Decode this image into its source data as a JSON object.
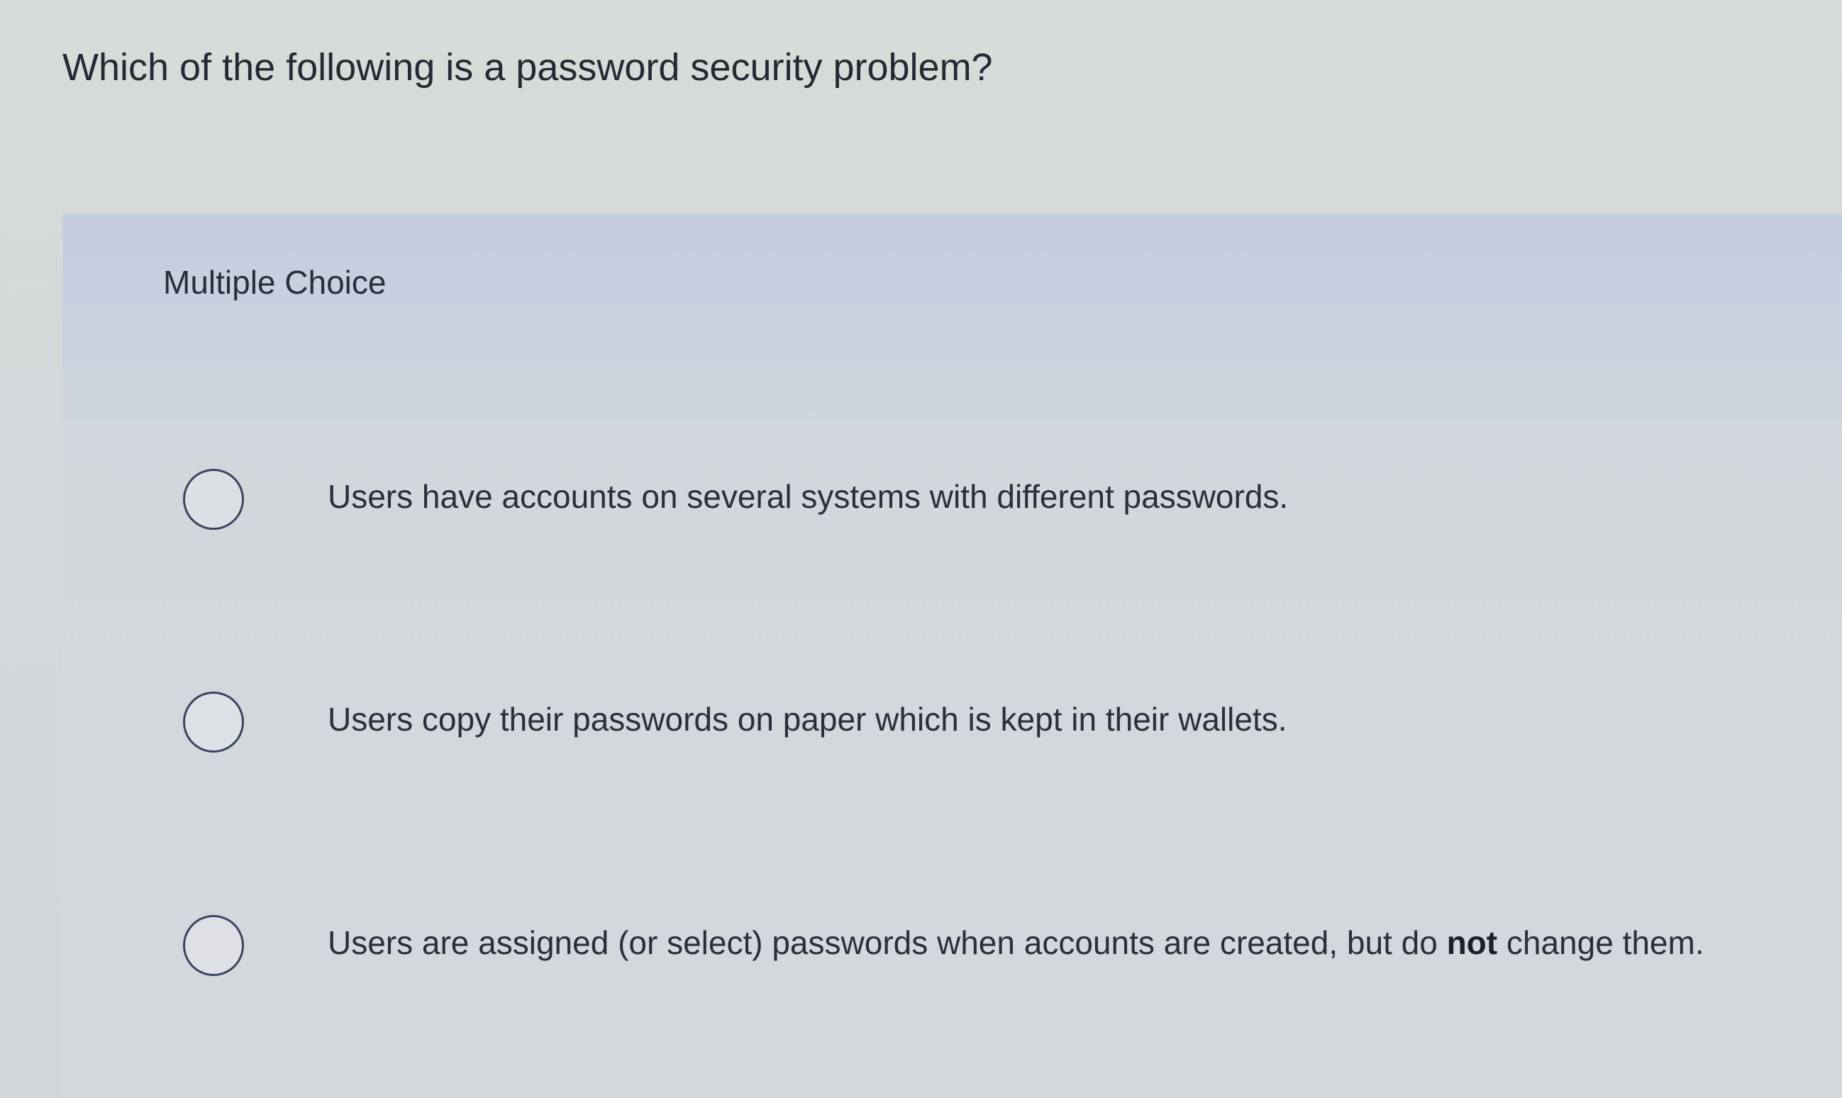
{
  "question": {
    "text": "Which of the following is a password security problem?"
  },
  "question_type": {
    "label": "Multiple Choice"
  },
  "choices": [
    {
      "text": "Users have accounts on several systems with different passwords.",
      "selected": false
    },
    {
      "text": "Users copy their passwords on paper which is kept in their wallets.",
      "selected": false
    },
    {
      "text_before": "Users are assigned (or select) passwords when accounts are created, but do ",
      "text_bold": "not",
      "text_after": " change them.",
      "selected": false
    }
  ],
  "colors": {
    "background": "#d6dad9",
    "header_band": "#c6cfe0",
    "radio_border": "#3b4460",
    "text": "#2a2d3a"
  }
}
